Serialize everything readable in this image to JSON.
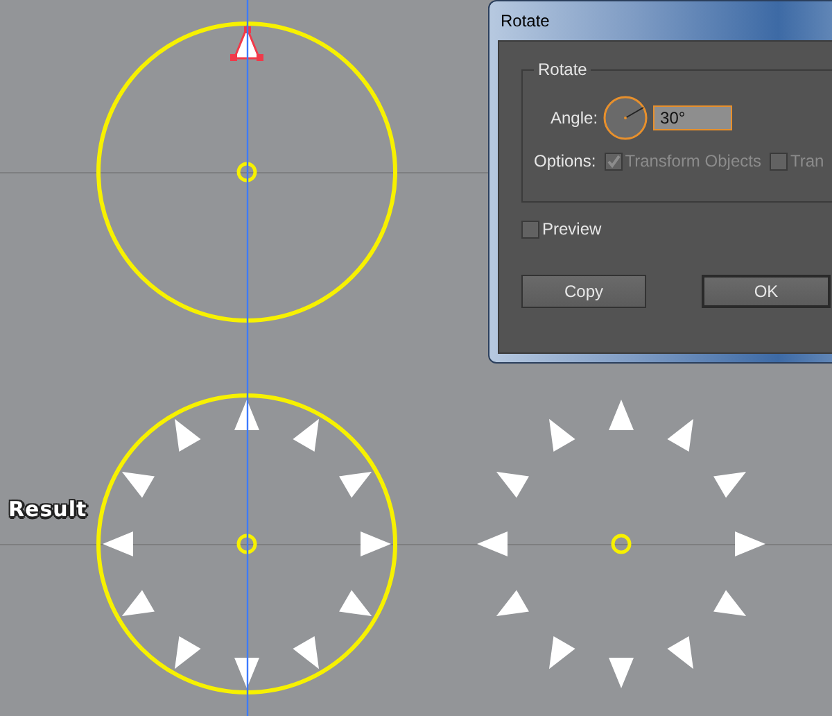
{
  "canvas": {
    "result_label": "Result",
    "groups": [
      {
        "kind": "original",
        "circle": true
      },
      {
        "kind": "rotated",
        "circle": true
      },
      {
        "kind": "rotated",
        "circle": false
      }
    ]
  },
  "dialog": {
    "title": "Rotate",
    "group_title": "Rotate",
    "angle_label": "Angle:",
    "angle_value": "30°",
    "options_label": "Options:",
    "options": [
      {
        "label": "Transform Objects",
        "checked": true,
        "disabled": true
      },
      {
        "label": "Tran",
        "checked": false,
        "disabled": true
      }
    ],
    "preview": {
      "label": "Preview",
      "checked": false
    },
    "buttons": [
      {
        "label": "Copy",
        "default": false
      },
      {
        "label": "OK",
        "default": true
      }
    ]
  }
}
